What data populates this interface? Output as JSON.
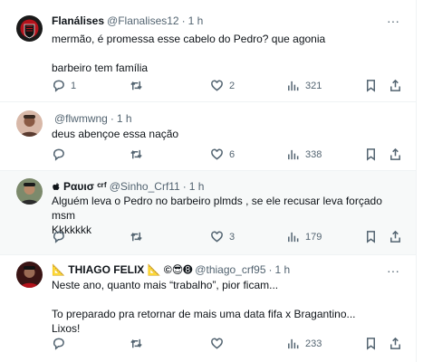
{
  "tweets": [
    {
      "name": "Flanálises",
      "handle": "@Flanalises12",
      "sep": "·",
      "time": "1 h",
      "lines": [
        "mermão, é promessa esse cabelo do Pedro? que agonia",
        "",
        "barbeiro tem família"
      ],
      "replies": "1",
      "retweets": "",
      "likes": "2",
      "views": "321",
      "avatar_color": "#7a0f14"
    },
    {
      "name": "",
      "handle": "@flwmwng",
      "sep": "·",
      "time": "1 h",
      "lines": [
        "deus abençoe essa nação"
      ],
      "replies": "",
      "retweets": "",
      "likes": "6",
      "views": "338",
      "avatar_color": "#b8877a"
    },
    {
      "name": " Ραυισ ᶜʳᶠ",
      "handle": "@Sinho_Crf11",
      "sep": "·",
      "time": "1 h",
      "lines": [
        "Alguém leva o Pedro no barbeiro plmds , se ele recusar leva forçado msm",
        "Kkkkkkk"
      ],
      "replies": "",
      "retweets": "",
      "likes": "3",
      "views": "179",
      "avatar_color": "#5e6b52"
    },
    {
      "name": "📐 THIAGO FELIX 📐 ©😎➑",
      "handle": "@thiago_crf95",
      "sep": "·",
      "time": "1 h",
      "lines": [
        "Neste ano, quanto mais “trabalho”, pior ficam...",
        "",
        "To preparado pra retornar de mais uma data fifa x Bragantino...",
        "Lixos!"
      ],
      "replies": "",
      "retweets": "",
      "likes": "",
      "views": "233",
      "avatar_color": "#4a1a1a"
    }
  ],
  "more_label": "···"
}
